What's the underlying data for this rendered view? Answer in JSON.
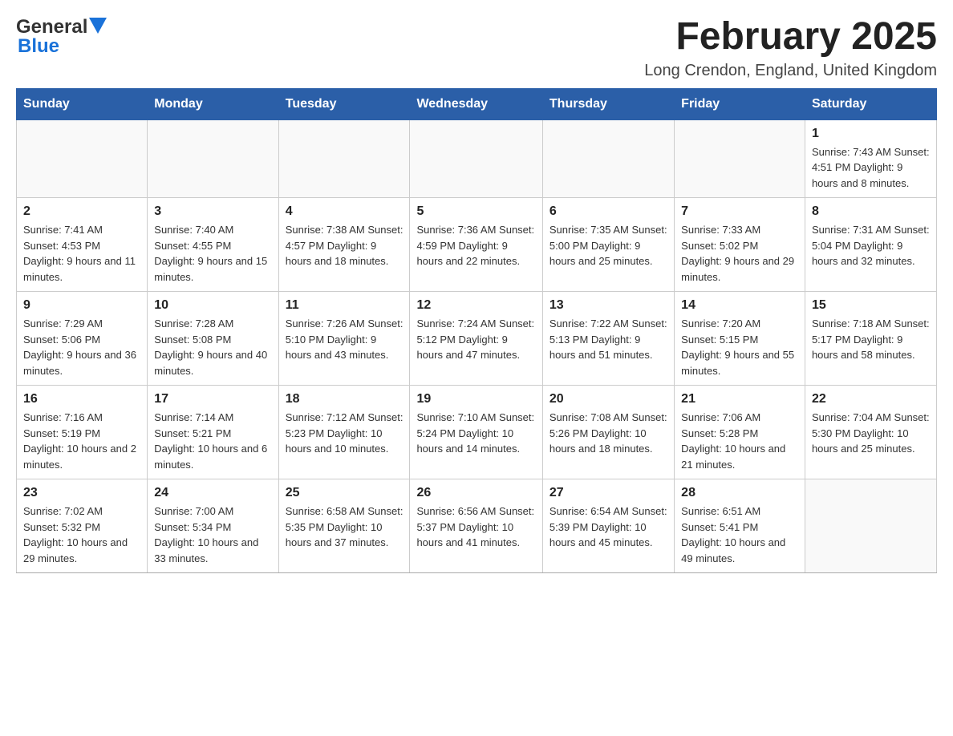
{
  "header": {
    "logo": {
      "general": "General",
      "blue": "Blue"
    },
    "title": "February 2025",
    "subtitle": "Long Crendon, England, United Kingdom"
  },
  "calendar": {
    "days_of_week": [
      "Sunday",
      "Monday",
      "Tuesday",
      "Wednesday",
      "Thursday",
      "Friday",
      "Saturday"
    ],
    "weeks": [
      {
        "days": [
          {
            "number": "",
            "info": ""
          },
          {
            "number": "",
            "info": ""
          },
          {
            "number": "",
            "info": ""
          },
          {
            "number": "",
            "info": ""
          },
          {
            "number": "",
            "info": ""
          },
          {
            "number": "",
            "info": ""
          },
          {
            "number": "1",
            "info": "Sunrise: 7:43 AM\nSunset: 4:51 PM\nDaylight: 9 hours and 8 minutes."
          }
        ]
      },
      {
        "days": [
          {
            "number": "2",
            "info": "Sunrise: 7:41 AM\nSunset: 4:53 PM\nDaylight: 9 hours and 11 minutes."
          },
          {
            "number": "3",
            "info": "Sunrise: 7:40 AM\nSunset: 4:55 PM\nDaylight: 9 hours and 15 minutes."
          },
          {
            "number": "4",
            "info": "Sunrise: 7:38 AM\nSunset: 4:57 PM\nDaylight: 9 hours and 18 minutes."
          },
          {
            "number": "5",
            "info": "Sunrise: 7:36 AM\nSunset: 4:59 PM\nDaylight: 9 hours and 22 minutes."
          },
          {
            "number": "6",
            "info": "Sunrise: 7:35 AM\nSunset: 5:00 PM\nDaylight: 9 hours and 25 minutes."
          },
          {
            "number": "7",
            "info": "Sunrise: 7:33 AM\nSunset: 5:02 PM\nDaylight: 9 hours and 29 minutes."
          },
          {
            "number": "8",
            "info": "Sunrise: 7:31 AM\nSunset: 5:04 PM\nDaylight: 9 hours and 32 minutes."
          }
        ]
      },
      {
        "days": [
          {
            "number": "9",
            "info": "Sunrise: 7:29 AM\nSunset: 5:06 PM\nDaylight: 9 hours and 36 minutes."
          },
          {
            "number": "10",
            "info": "Sunrise: 7:28 AM\nSunset: 5:08 PM\nDaylight: 9 hours and 40 minutes."
          },
          {
            "number": "11",
            "info": "Sunrise: 7:26 AM\nSunset: 5:10 PM\nDaylight: 9 hours and 43 minutes."
          },
          {
            "number": "12",
            "info": "Sunrise: 7:24 AM\nSunset: 5:12 PM\nDaylight: 9 hours and 47 minutes."
          },
          {
            "number": "13",
            "info": "Sunrise: 7:22 AM\nSunset: 5:13 PM\nDaylight: 9 hours and 51 minutes."
          },
          {
            "number": "14",
            "info": "Sunrise: 7:20 AM\nSunset: 5:15 PM\nDaylight: 9 hours and 55 minutes."
          },
          {
            "number": "15",
            "info": "Sunrise: 7:18 AM\nSunset: 5:17 PM\nDaylight: 9 hours and 58 minutes."
          }
        ]
      },
      {
        "days": [
          {
            "number": "16",
            "info": "Sunrise: 7:16 AM\nSunset: 5:19 PM\nDaylight: 10 hours and 2 minutes."
          },
          {
            "number": "17",
            "info": "Sunrise: 7:14 AM\nSunset: 5:21 PM\nDaylight: 10 hours and 6 minutes."
          },
          {
            "number": "18",
            "info": "Sunrise: 7:12 AM\nSunset: 5:23 PM\nDaylight: 10 hours and 10 minutes."
          },
          {
            "number": "19",
            "info": "Sunrise: 7:10 AM\nSunset: 5:24 PM\nDaylight: 10 hours and 14 minutes."
          },
          {
            "number": "20",
            "info": "Sunrise: 7:08 AM\nSunset: 5:26 PM\nDaylight: 10 hours and 18 minutes."
          },
          {
            "number": "21",
            "info": "Sunrise: 7:06 AM\nSunset: 5:28 PM\nDaylight: 10 hours and 21 minutes."
          },
          {
            "number": "22",
            "info": "Sunrise: 7:04 AM\nSunset: 5:30 PM\nDaylight: 10 hours and 25 minutes."
          }
        ]
      },
      {
        "days": [
          {
            "number": "23",
            "info": "Sunrise: 7:02 AM\nSunset: 5:32 PM\nDaylight: 10 hours and 29 minutes."
          },
          {
            "number": "24",
            "info": "Sunrise: 7:00 AM\nSunset: 5:34 PM\nDaylight: 10 hours and 33 minutes."
          },
          {
            "number": "25",
            "info": "Sunrise: 6:58 AM\nSunset: 5:35 PM\nDaylight: 10 hours and 37 minutes."
          },
          {
            "number": "26",
            "info": "Sunrise: 6:56 AM\nSunset: 5:37 PM\nDaylight: 10 hours and 41 minutes."
          },
          {
            "number": "27",
            "info": "Sunrise: 6:54 AM\nSunset: 5:39 PM\nDaylight: 10 hours and 45 minutes."
          },
          {
            "number": "28",
            "info": "Sunrise: 6:51 AM\nSunset: 5:41 PM\nDaylight: 10 hours and 49 minutes."
          },
          {
            "number": "",
            "info": ""
          }
        ]
      }
    ]
  }
}
